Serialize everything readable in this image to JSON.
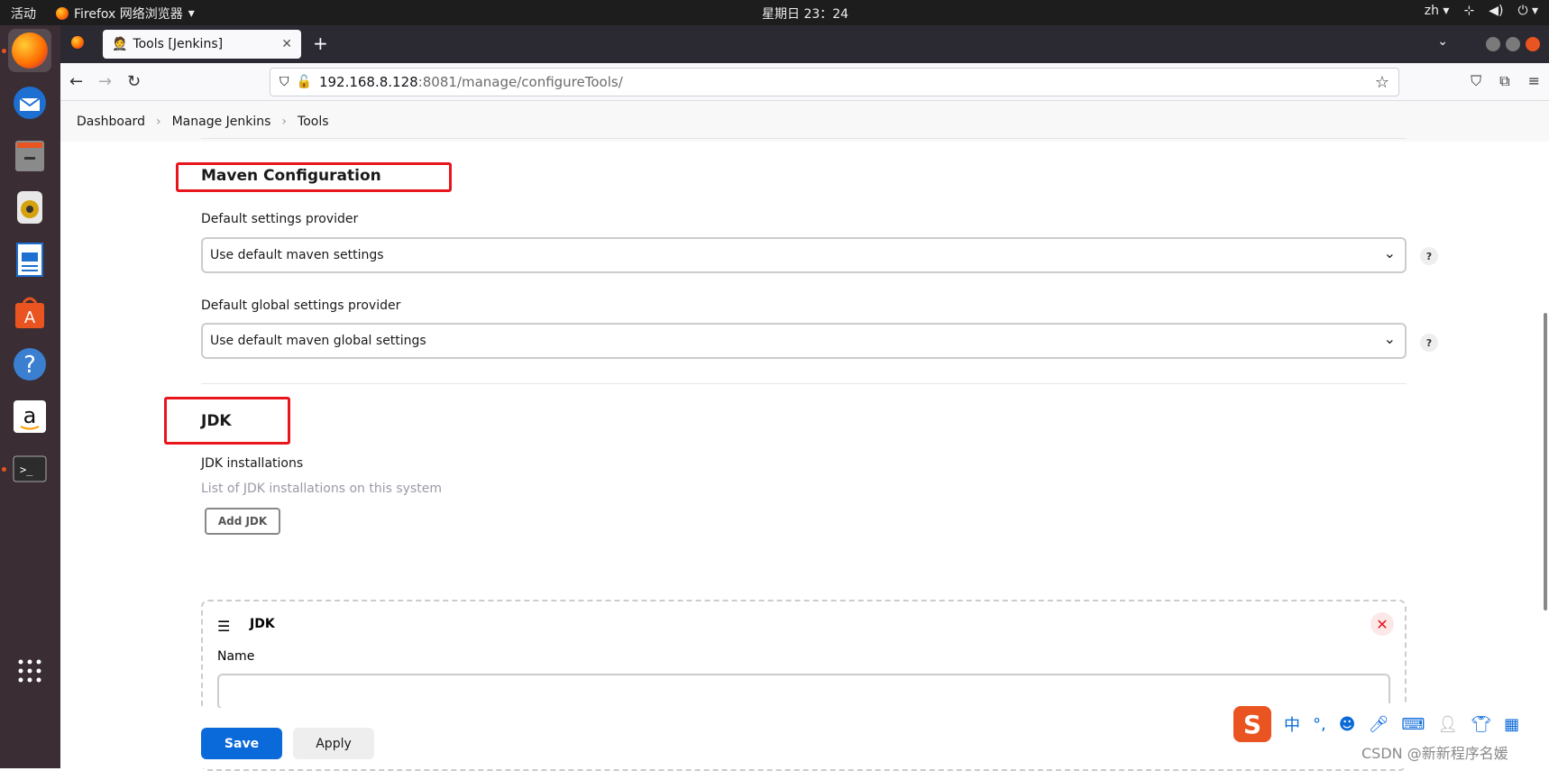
{
  "topbar": {
    "activities": "活动",
    "app_name": "Firefox 网络浏览器",
    "clock": "星期日 23：24",
    "lang": "zh"
  },
  "browser": {
    "tab_title": "Tools [Jenkins]",
    "url_host": "192.168.8.128",
    "url_path": ":8081/manage/configureTools/"
  },
  "breadcrumb": {
    "items": [
      "Dashboard",
      "Manage Jenkins",
      "Tools"
    ]
  },
  "maven": {
    "title": "Maven Configuration",
    "settings_label": "Default settings provider",
    "settings_value": "Use default maven settings",
    "global_label": "Default global settings provider",
    "global_value": "Use default maven global settings"
  },
  "jdk": {
    "title": "JDK",
    "installations_label": "JDK installations",
    "installations_desc": "List of JDK installations on this system",
    "add_button": "Add JDK",
    "item_title": "JDK",
    "name_label": "Name",
    "name_value": ""
  },
  "actions": {
    "save": "Save",
    "apply": "Apply"
  },
  "help_glyph": "?",
  "watermark": "CSDN @新新程序名媛",
  "ime": {
    "mode": "中",
    "punct": "°,"
  },
  "colors": {
    "accent": "#0b6ad9",
    "highlight_box": "#e8151c",
    "dock_bg": "#3a2d33"
  }
}
